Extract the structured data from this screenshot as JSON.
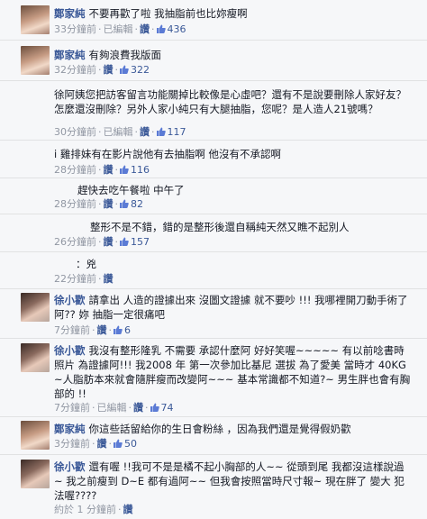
{
  "like_label": "讚",
  "edited_label": "已編輯",
  "comments": [
    {
      "author": "鄭家純",
      "text": "不要再歡了啦 我抽脂前也比妳瘦啊",
      "time": "33分鐘前",
      "edited": true,
      "likes": "436"
    },
    {
      "author": "鄭家純",
      "text": "有夠浪費我版面",
      "time": "32分鐘前",
      "edited": false,
      "likes": "322"
    },
    {
      "author": "",
      "text": "徐阿姨您把訪客留言功能關掉比較像是心虛吧？還有不是說要刪除人家好友？怎麼還沒刪除？另外人家小純只有大腿抽脂，您呢？是人造人21號嗎？",
      "time": "30分鐘前",
      "edited": true,
      "likes": "117"
    },
    {
      "author": "",
      "text": "i 雞排妹有在影片說他有去抽脂啊 他沒有不承認啊",
      "time": "28分鐘前",
      "edited": false,
      "likes": "116"
    },
    {
      "author": "",
      "text": "趕快去吃午餐啦 中午了",
      "time": "28分鐘前",
      "edited": false,
      "likes": "82"
    },
    {
      "author": "",
      "text": "整形不是不錯，錯的是整形後還自稱純天然又瞧不起別人",
      "time": "26分鐘前",
      "edited": false,
      "likes": "157"
    },
    {
      "author": "",
      "text": "：兇",
      "time": "22分鐘前",
      "edited": false,
      "likes": ""
    },
    {
      "author": "徐小歡",
      "text": "請拿出 人造的證據出來 沒圖文證據 就不要吵 !!! 我哪裡開刀動手術了阿?? 妳 抽脂一定很痛吧",
      "time": "7分鐘前",
      "edited": false,
      "likes": "6"
    },
    {
      "author": "徐小歡",
      "text": "我沒有整形隆乳 不需要 承認什麼阿 好好笑喔~~~~~ 有以前唸書時照片 為證據阿!!! 我2008 年 第一次參加比基尼 選拔 為了愛美 當時才 40KG ~人脂肪本來就會隨胖瘦而改變阿~~~ 基本常識都不知道?~ 男生胖也會有胸部的 !!",
      "time": "7分鐘前",
      "edited": true,
      "likes": "74"
    },
    {
      "author": "鄭家純",
      "text": "你這些話留給你的生日會粉絲 ，因為我們還是覺得假奶歡",
      "time": "3分鐘前",
      "edited": false,
      "likes": "50"
    },
    {
      "author": "徐小歡",
      "text": "還有喔 !!我可不是是橘不起小胸部的人~~ 從頭到尾 我都沒這樣說過~ 我之前瘦到 D~E 都有過阿~~ 但我會按照當時尺寸報~ 現在胖了 變大 犯法喔????",
      "time": "約於 1 分鐘前",
      "edited": false,
      "likes": ""
    }
  ]
}
